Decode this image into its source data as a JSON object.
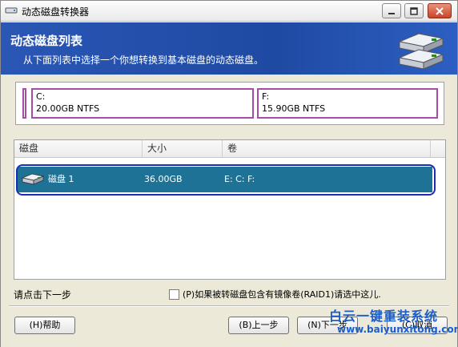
{
  "window": {
    "title": "动态磁盘转换器"
  },
  "header": {
    "title": "动态磁盘列表",
    "subtitle": "从下面列表中选择一个你想转换到基本磁盘的动态磁盘。"
  },
  "volumes": [
    {
      "letter": "C:",
      "info": "20.00GB NTFS"
    },
    {
      "letter": "F:",
      "info": "15.90GB NTFS"
    }
  ],
  "list": {
    "columns": [
      "磁盘",
      "大小",
      "卷"
    ],
    "rows": [
      {
        "name": "磁盘 1",
        "size": "36.00GB",
        "volumes": "E:   C:   F:"
      }
    ]
  },
  "footer": {
    "hint": "请点击下一步",
    "raid_checkbox_label": "(P)如果被转磁盘包含有镜像卷(RAID1)请选中这儿.",
    "raid_checked": false
  },
  "buttons": {
    "help": "(H)帮助",
    "prev": "(B)上一步",
    "next": "(N)下一步",
    "cancel": "(C)取消"
  },
  "watermark": {
    "text": "白云一键重装系统",
    "url": "www.baiyunxitong.com"
  },
  "colors": {
    "header_blue": "#1f4aa3",
    "selection": "#1e7295",
    "volume_border": "#a64ca6",
    "watermark": "#1c5ec9"
  }
}
